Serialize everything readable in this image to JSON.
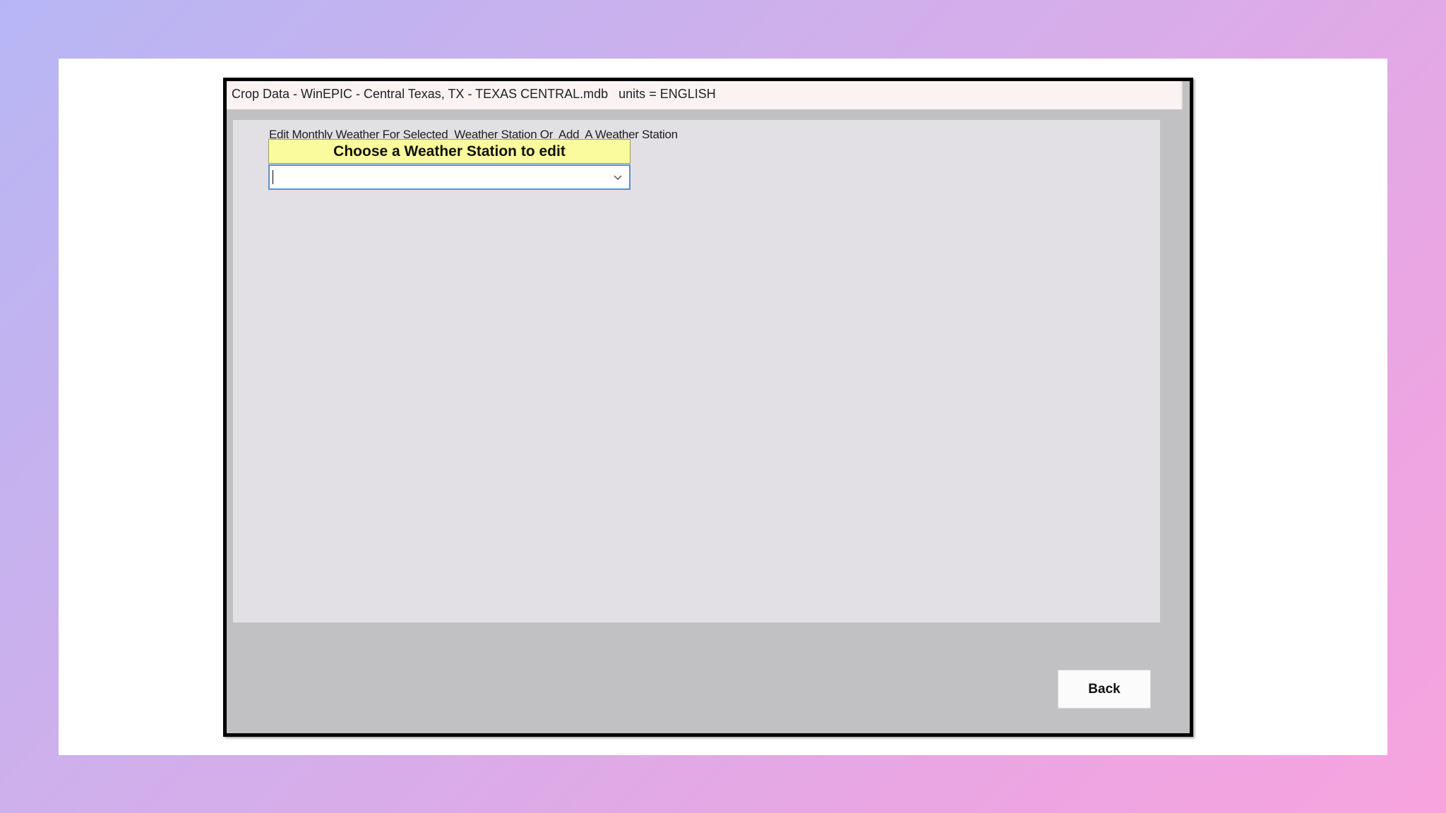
{
  "window": {
    "title": "Crop Data - WinEPIC - Central Texas, TX - TEXAS CENTRAL.mdb   units = ENGLISH"
  },
  "main": {
    "instruction": "Edit Monthly Weather For Selected  Weather Station Or  Add  A Weather Station",
    "choose_label": "Choose a Weather Station to edit",
    "station_select": {
      "value": "",
      "icon": "chevron-down-icon"
    }
  },
  "footer": {
    "back_label": "Back"
  },
  "colors": {
    "label_background": "#fafb9c",
    "select_border": "#5b8fd6",
    "window_background": "#c1c0c3",
    "panel_background": "#e2e0e4"
  }
}
